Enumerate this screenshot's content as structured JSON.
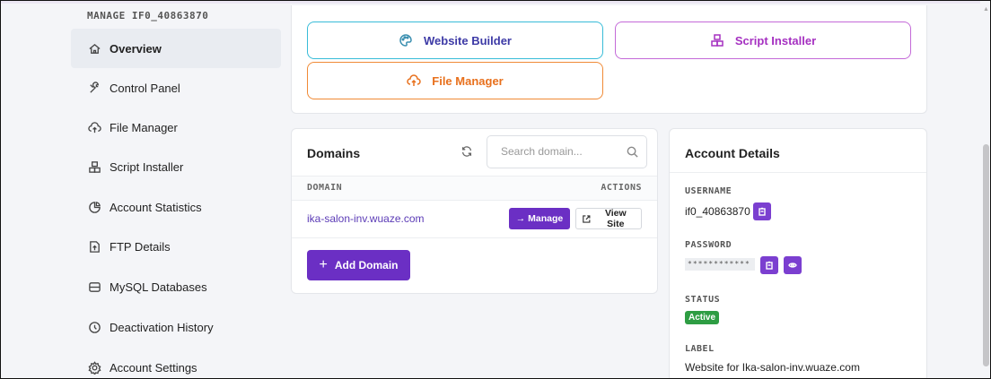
{
  "sidebar": {
    "title": "MANAGE IF0_40863870",
    "items": [
      {
        "label": "Overview",
        "icon": "home-icon",
        "active": true
      },
      {
        "label": "Control Panel",
        "icon": "tools-icon"
      },
      {
        "label": "File Manager",
        "icon": "cloud-upload-icon"
      },
      {
        "label": "Script Installer",
        "icon": "cubes-icon"
      },
      {
        "label": "Account Statistics",
        "icon": "chart-icon"
      },
      {
        "label": "FTP Details",
        "icon": "file-upload-icon"
      },
      {
        "label": "MySQL Databases",
        "icon": "database-icon"
      },
      {
        "label": "Deactivation History",
        "icon": "history-icon"
      },
      {
        "label": "Account Settings",
        "icon": "gear-icon"
      }
    ]
  },
  "quick": {
    "website_builder": "Website Builder",
    "script_installer": "Script Installer",
    "file_manager": "File Manager"
  },
  "domains": {
    "title": "Domains",
    "search_placeholder": "Search domain...",
    "col_domain": "DOMAIN",
    "col_actions": "ACTIONS",
    "rows": [
      {
        "domain": "ika-salon-inv.wuaze.com",
        "manage": "→ Manage",
        "view": "View Site"
      }
    ],
    "add_label": "Add Domain"
  },
  "account": {
    "title": "Account Details",
    "username_label": "USERNAME",
    "username": "if0_40863870",
    "password_label": "PASSWORD",
    "password_mask": "************",
    "status_label": "STATUS",
    "status": "Active",
    "label_label": "LABEL",
    "label_value": "Website for Ika-salon-inv.wuaze.com"
  },
  "colors": {
    "accent": "#6b2fc4",
    "status_active": "#2e9d43",
    "website_builder_border": "#38bcd8",
    "script_installer_border": "#c46ad8",
    "file_manager_border": "#f08a36"
  }
}
